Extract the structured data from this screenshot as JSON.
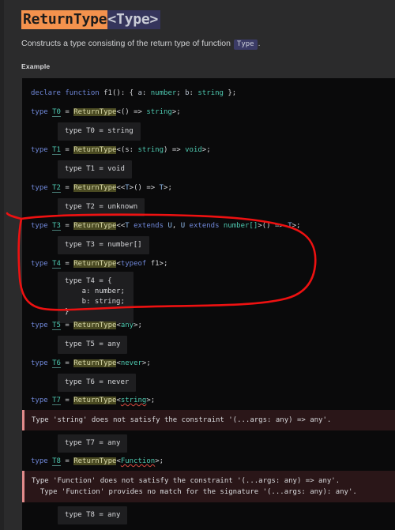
{
  "header": {
    "title_name": "ReturnType",
    "title_param": "<Type>",
    "description_before": "Constructs a type consisting of the return type of function",
    "description_code": "Type",
    "description_after": ".",
    "example_heading": "Example"
  },
  "code": {
    "declare_line": {
      "kw_declare": "declare",
      "kw_function": "function",
      "fn_name": "f1",
      "punc_open": "(): { ",
      "prop_a": "a",
      "colon1": ": ",
      "type_number": "number",
      "semi1": "; ",
      "prop_b": "b",
      "colon2": ": ",
      "type_string": "string",
      "close": " };"
    },
    "t0": {
      "kw": "type",
      "alias": "T0",
      "eq": " = ",
      "util": "ReturnType",
      "args_pre": "<() => ",
      "args_type": "string",
      "args_post": ">;"
    },
    "t0_info": "type T0 = string",
    "t1": {
      "kw": "type",
      "alias": "T1",
      "eq": " = ",
      "util": "ReturnType",
      "args_pre": "<(s: ",
      "args_type": "string",
      "args_mid": ") => ",
      "args_type2": "void",
      "args_post": ">;"
    },
    "t1_info": "type T1 = void",
    "t2": {
      "kw": "type",
      "alias": "T2",
      "eq": " = ",
      "util": "ReturnType",
      "args_pre": "<<",
      "args_T": "T",
      "args_mid": ">() => ",
      "args_T2": "T",
      "args_post": ">;"
    },
    "t2_info": "type T2 = unknown",
    "t3": {
      "kw": "type",
      "alias": "T3",
      "eq": " = ",
      "util": "ReturnType",
      "args_pre": "<<",
      "args_T": "T",
      "kw_extends1": " extends ",
      "args_U": "U",
      "comma": ", ",
      "args_U2": "U",
      "kw_extends2": " extends ",
      "args_number": "number[]",
      "args_mid": ">() => ",
      "args_T2": "T",
      "args_post": ">;"
    },
    "t3_info": "type T3 = number[]",
    "t4": {
      "kw": "type",
      "alias": "T4",
      "eq": " = ",
      "util": "ReturnType",
      "args_pre": "<",
      "kw_typeof": "typeof",
      "fn": " f1",
      "args_post": ">;"
    },
    "t4_info": "type T4 = {\n    a: number;\n    b: string;\n}",
    "t5": {
      "kw": "type",
      "alias": "T5",
      "eq": " = ",
      "util": "ReturnType",
      "args_pre": "<",
      "args_type": "any",
      "args_post": ">;"
    },
    "t5_info": "type T5 = any",
    "t6": {
      "kw": "type",
      "alias": "T6",
      "eq": " = ",
      "util": "ReturnType",
      "args_pre": "<",
      "args_type": "never",
      "args_post": ">;"
    },
    "t6_info": "type T6 = never",
    "t7": {
      "kw": "type",
      "alias": "T7",
      "eq": " = ",
      "util": "ReturnType",
      "args_pre": "<",
      "args_type": "string",
      "args_post": ">;"
    },
    "t7_error": "Type 'string' does not satisfy the constraint '(...args: any) => any'.",
    "t7_info": "type T7 = any",
    "t8": {
      "kw": "type",
      "alias": "T8",
      "eq": " = ",
      "util": "ReturnType",
      "args_pre": "<",
      "args_type": "Function",
      "args_post": ">;"
    },
    "t8_error": "Type 'Function' does not satisfy the constraint '(...args: any) => any'.\n  Type 'Function' provides no match for the signature '(...args: any): any'.",
    "t8_info": "type T8 = any"
  },
  "annotation": {
    "kind": "hand-drawn-red-ellipse",
    "color": "#ee1111"
  },
  "colors": {
    "page_background": "#2b2b2c",
    "code_background": "#0a0a0b",
    "title_highlight": "#f4924d",
    "title_param_background": "#35355c",
    "utility_highlight": "#4a4a22",
    "error_background": "#2a1618",
    "error_border": "#e28b8b",
    "annotation": "#ee1111"
  }
}
